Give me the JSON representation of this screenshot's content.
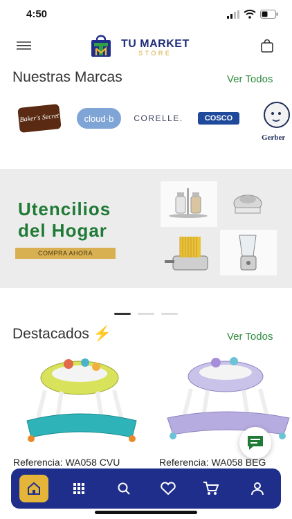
{
  "status_bar": {
    "time": "4:50"
  },
  "header": {
    "logo_title": "TU MARKET",
    "logo_subtitle": "STORE"
  },
  "brands_section": {
    "title": "Nuestras Marcas",
    "see_all": "Ver Todos",
    "brands": [
      "Baker's Secret",
      "cloud·b",
      "CORELLE.",
      "COSCO",
      "Gerber"
    ]
  },
  "banner": {
    "title_line1": "Utencilios",
    "title_line2": "del Hogar",
    "cta": "COMPRA AHORA"
  },
  "featured_section": {
    "title": "Destacados",
    "title_icon": "⚡",
    "see_all": "Ver Todos",
    "products": [
      {
        "reference": "Referencia: WA058 CVU"
      },
      {
        "reference": "Referencia: WA058 BEG"
      }
    ]
  },
  "colors": {
    "brand_navy": "#1f2e8a",
    "brand_green": "#1f7a35",
    "accent_gold": "#e5b53a",
    "link_green": "#2c8a3c"
  },
  "bottom_nav": {
    "items": [
      "home-icon",
      "grid-icon",
      "search-icon",
      "heart-icon",
      "cart-icon",
      "user-icon"
    ],
    "active": "home-icon"
  }
}
